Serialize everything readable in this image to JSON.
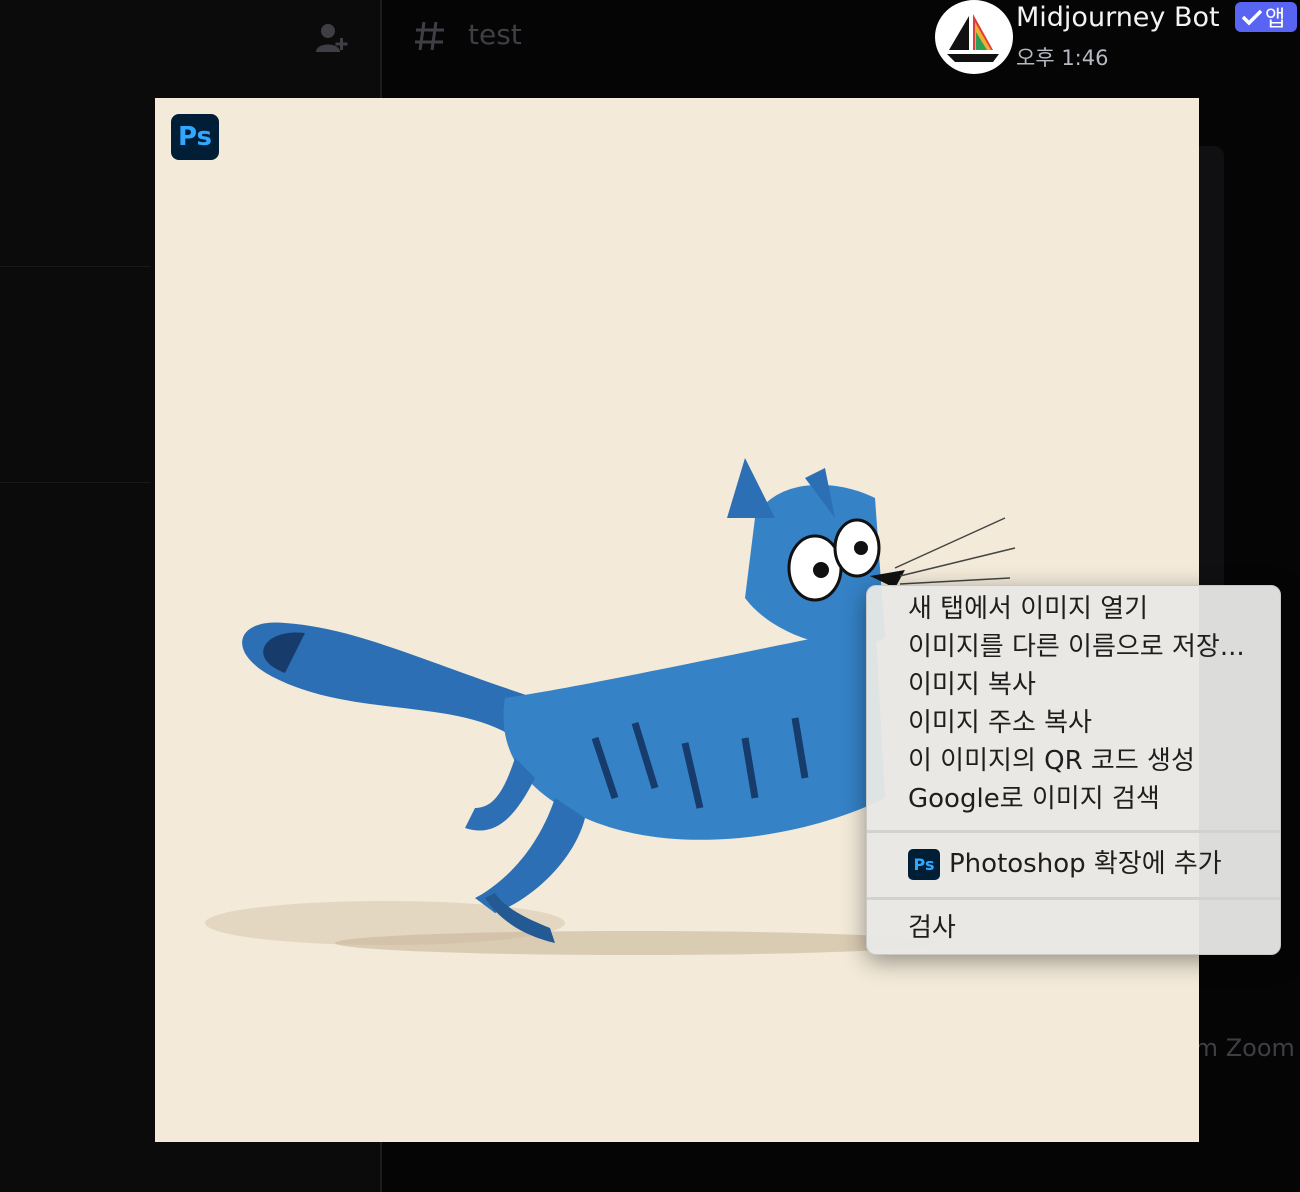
{
  "background": {
    "channel_name": "test",
    "zoom_text": "om Zoom"
  },
  "header": {
    "bot_name": "Midjourney Bot",
    "app_badge": "앱",
    "timestamp": "오후 1:46"
  },
  "image": {
    "ps_badge": "Ps"
  },
  "context_menu": {
    "items": [
      "새 탭에서 이미지 열기",
      "이미지를 다른 이름으로 저장...",
      "이미지 복사",
      "이미지 주소 복사",
      "이 이미지의 QR 코드 생성",
      "Google로 이미지 검색"
    ],
    "ps_icon": "Ps",
    "photoshop_label": "Photoshop 확장에 추가",
    "inspect_label": "검사"
  },
  "colors": {
    "accent": "#5865f2",
    "image_background": "#f3ead9",
    "cat_blue": "#2f7dc1"
  }
}
